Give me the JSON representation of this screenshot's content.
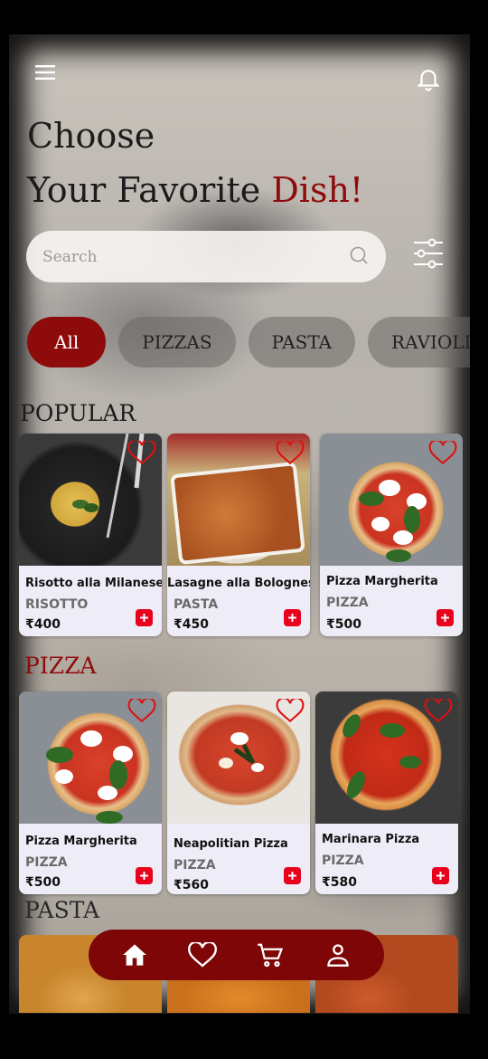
{
  "header": {
    "menu_icon": "hamburger-menu-icon",
    "notification_icon": "bell-icon",
    "title_line1": "Choose",
    "title_line2_prefix": "Your Favorite ",
    "title_line2_accent": "Dish!"
  },
  "search": {
    "placeholder": "Search",
    "value": "",
    "icon": "search-icon",
    "filter_icon": "sliders-filter-icon"
  },
  "categories": {
    "items": [
      "All",
      "PIZZAS",
      "PASTA",
      "RAVIOLI"
    ],
    "selected": "All"
  },
  "sections": {
    "popular": {
      "title": "POPULAR",
      "items": [
        {
          "name": "Risotto alla Milanese",
          "category": "RISOTTO",
          "price": "₹400"
        },
        {
          "name": "Lasagne alla Bolognese",
          "category": "PASTA",
          "price": "₹450"
        },
        {
          "name": "Pizza Margherita",
          "category": "PIZZA",
          "price": "₹500"
        }
      ]
    },
    "pizza": {
      "title": "PIZZA",
      "items": [
        {
          "name": "Pizza Margherita",
          "category": "PIZZA",
          "price": "₹500"
        },
        {
          "name": "Neapolitian Pizza",
          "category": "PIZZA",
          "price": "₹560"
        },
        {
          "name": "Marinara Pizza",
          "category": "PIZZA",
          "price": "₹580"
        }
      ]
    },
    "pasta": {
      "title": "PASTA"
    }
  },
  "bottom_nav": {
    "items": [
      "home-icon",
      "heart-icon",
      "cart-icon",
      "profile-icon"
    ],
    "active": "home-icon"
  },
  "colors": {
    "accent": "#8e0b0b",
    "add_button": "#e8001c",
    "nav_bar": "#7e0606",
    "card_bg": "#eeedf7"
  }
}
